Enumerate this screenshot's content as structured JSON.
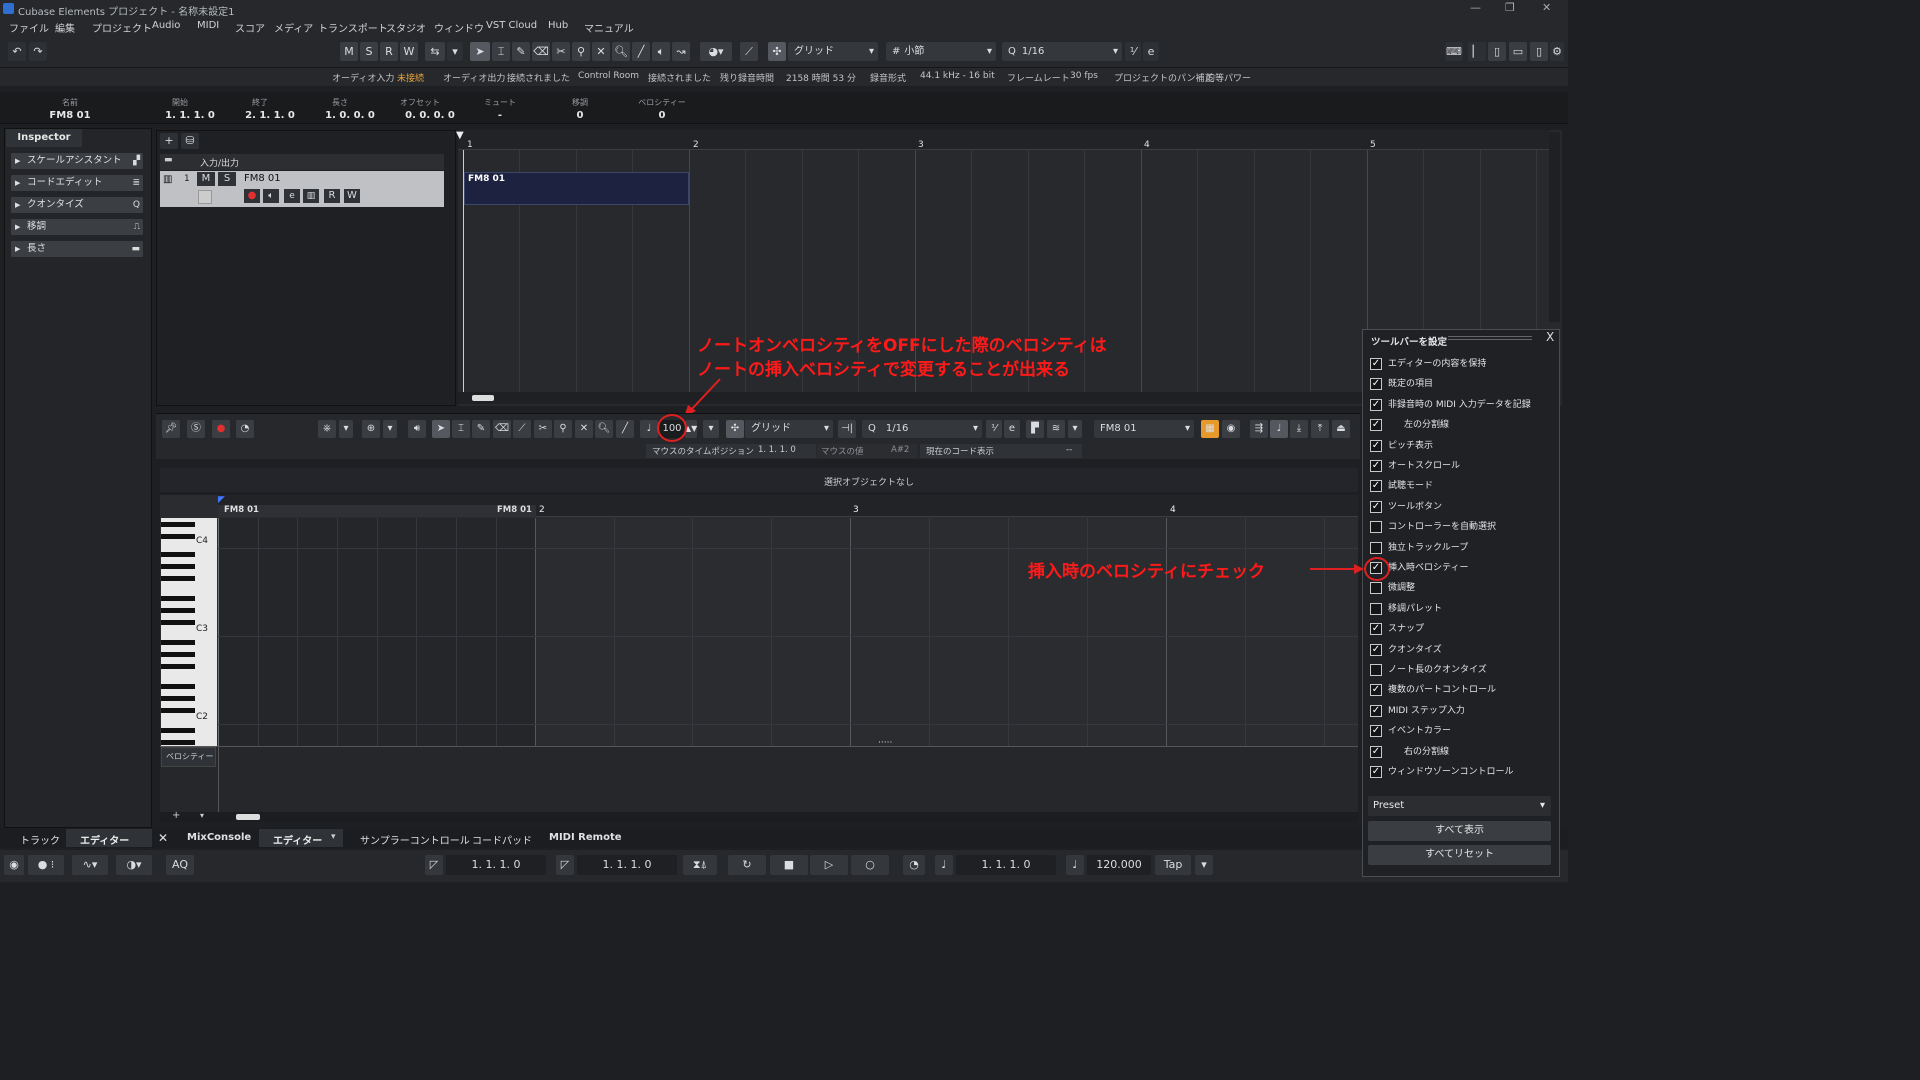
{
  "window": {
    "title": "Cubase Elements プロジェクト - 名称未設定1"
  },
  "menu": [
    "ファイル",
    "編集",
    "プロジェクト",
    "Audio",
    "MIDI",
    "スコア",
    "メディア",
    "トランスポート",
    "スタジオ",
    "ウィンドウ",
    "VST Cloud",
    "Hub",
    "マニュアル"
  ],
  "toolbar": {
    "m": "M",
    "s": "S",
    "r": "R",
    "w": "W",
    "snap_type": "グリッド",
    "grid": "小節",
    "quantize": "1/16"
  },
  "status": {
    "audio_in": "オーディオ入力",
    "audio_in_state": "未接続",
    "audio_out": "オーディオ出力",
    "audio_out_state": "接続されました",
    "control_room": "Control Room",
    "control_room_state": "接続されました",
    "rec_time_label": "残り録音時間",
    "rec_time": "2158 時間 53 分",
    "rec_format_label": "録音形式",
    "rec_format": "44.1 kHz - 16 bit",
    "frame_label": "フレームレート",
    "frame": "30 fps",
    "pan_label": "プロジェクトのパン補正",
    "pan": "均等パワー"
  },
  "infoline": {
    "name_label": "名前",
    "name": "FM8 01",
    "start_label": "開始",
    "start": "1. 1. 1.  0",
    "end_label": "終了",
    "end": "2. 1. 1.  0",
    "length_label": "長さ",
    "length": "1. 0. 0.  0",
    "offset_label": "オフセット",
    "offset": "0. 0. 0.  0",
    "mute_label": "ミュート",
    "mute": "-",
    "transpose_label": "移調",
    "transpose": "0",
    "velocity_label": "ベロシティー",
    "velocity": "0"
  },
  "inspector": {
    "tab": "Inspector",
    "sections": [
      "スケールアシスタント",
      "コードエディット",
      "クオンタイズ",
      "移調",
      "長さ"
    ]
  },
  "tracks": {
    "folder": "入力/出力",
    "track_num": "1",
    "m": "M",
    "s": "S",
    "name": "FM8 01",
    "r": "R",
    "w": "W"
  },
  "arrange": {
    "bars": [
      "1",
      "2",
      "3",
      "4",
      "5"
    ],
    "part_name": "FM8 01"
  },
  "annotation1": {
    "line1": "ノートオンベロシティをOFFにした際のベロシティは",
    "line2": "ノートの挿入ベロシティで変更することが出来る"
  },
  "annotation2": "挿入時のベロシティにチェック",
  "editor": {
    "velocity": "100",
    "snap_type": "グリッド",
    "quantize": "1/16",
    "track": "FM8 01",
    "mouse_pos_label": "マウスのタイムポジション",
    "mouse_pos": "1. 1. 1.  0",
    "mouse_val_label": "マウスの値",
    "mouse_val": "A#2",
    "chord_label": "現在のコード表示",
    "chord": "--",
    "no_selection": "選択オブジェクトなし",
    "part_a": "FM8 01",
    "part_b": "FM8 01",
    "bars": [
      "2",
      "3",
      "4"
    ],
    "keys": [
      "C4",
      "C3",
      "C2"
    ],
    "velo_lane": "ベロシティー"
  },
  "bottom_tabs": {
    "track": "トラック",
    "editor": "エディター",
    "mixconsole": "MixConsole",
    "editor2": "エディター",
    "sampler": "サンプラーコントロール",
    "chordpad": "コードパッド",
    "midiremote": "MIDI Remote"
  },
  "transport": {
    "aq": "AQ",
    "left_loc": "1. 1. 1.  0",
    "right_loc": "1. 1. 1.  0",
    "pos": "1. 1. 1.  0",
    "tempo": "120.000",
    "tap": "Tap"
  },
  "config": {
    "title": "ツールバーを設定",
    "close": "X",
    "items": [
      {
        "label": "エディターの内容を保持",
        "checked": true
      },
      {
        "label": "既定の項目",
        "checked": true
      },
      {
        "label": "非録音時の MIDI 入力データを記録",
        "checked": true
      },
      {
        "label": "左の分割線",
        "checked": true,
        "indent": true
      },
      {
        "label": "ピッチ表示",
        "checked": true
      },
      {
        "label": "オートスクロール",
        "checked": true
      },
      {
        "label": "試聴モード",
        "checked": true
      },
      {
        "label": "ツールボタン",
        "checked": true
      },
      {
        "label": "コントローラーを自動選択",
        "checked": false
      },
      {
        "label": "独立トラックループ",
        "checked": false
      },
      {
        "label": "挿入時ベロシティー",
        "checked": true
      },
      {
        "label": "微調整",
        "checked": false
      },
      {
        "label": "移調パレット",
        "checked": false
      },
      {
        "label": "スナップ",
        "checked": true
      },
      {
        "label": "クオンタイズ",
        "checked": true
      },
      {
        "label": "ノート長のクオンタイズ",
        "checked": false
      },
      {
        "label": "複数のパートコントロール",
        "checked": true
      },
      {
        "label": "MIDI ステップ入力",
        "checked": true
      },
      {
        "label": "イベントカラー",
        "checked": true
      },
      {
        "label": "右の分割線",
        "checked": true,
        "indent": true
      },
      {
        "label": "ウィンドウゾーンコントロール",
        "checked": true
      }
    ],
    "preset": "Preset",
    "show_all": "すべて表示",
    "reset_all": "すべてリセット"
  },
  "colors": {
    "annotation": "#ff1a1a",
    "record": "#e03030",
    "accent": "#2e6fd0"
  }
}
